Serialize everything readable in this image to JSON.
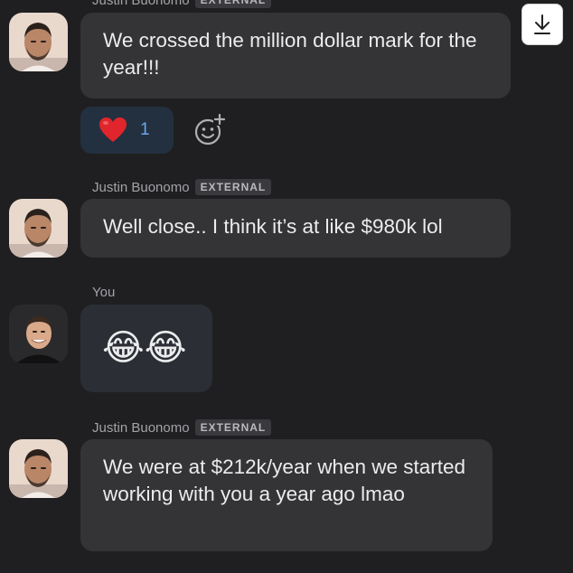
{
  "messages": [
    {
      "sender": "Justin Buonomo",
      "badge": "EXTERNAL",
      "text": "We crossed the million dollar mark for the year!!!",
      "reaction": {
        "emoji": "❤️",
        "count": "1"
      }
    },
    {
      "sender": "Justin Buonomo",
      "badge": "EXTERNAL",
      "text": "Well close.. I think it’s at like $980k lol"
    },
    {
      "sender": "You",
      "text": "😂😂"
    },
    {
      "sender": "Justin Buonomo",
      "badge": "EXTERNAL",
      "text": "We were at $212k/year when we started working with you a year ago lmao"
    }
  ],
  "icons": {
    "download": "download-icon",
    "add_reaction": "add-reaction-icon",
    "reaction": "heart-icon"
  },
  "colors": {
    "background": "#1f1f21",
    "bubble": "#343437",
    "own_bubble": "#2b2f35",
    "reaction_pill": "#23303f",
    "reaction_count": "#6ea6e8",
    "heart": "#e0262c"
  }
}
